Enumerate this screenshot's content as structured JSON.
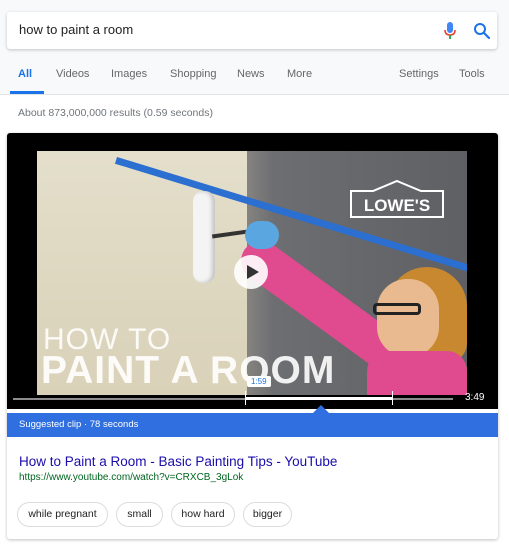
{
  "search": {
    "query": "how to paint a room"
  },
  "tabs": [
    {
      "label": "All",
      "active": true
    },
    {
      "label": "Videos"
    },
    {
      "label": "Images"
    },
    {
      "label": "Shopping"
    },
    {
      "label": "News"
    },
    {
      "label": "More"
    },
    {
      "label": "Settings"
    },
    {
      "label": "Tools"
    }
  ],
  "result_stats": "About 873,000,000 results (0.59 seconds)",
  "video": {
    "overlay_line1": "HOW TO",
    "overlay_line2": "PAINT A ROOM",
    "logo_text": "LOWE'S",
    "clip_timestamp": "1:59",
    "duration": "3:49",
    "suggested_clip": "Suggested clip · 78 seconds"
  },
  "result": {
    "title": "How to Paint a Room - Basic Painting Tips - YouTube",
    "url": "https://www.youtube.com/watch?v=CRXCB_3gLok"
  },
  "chips": [
    "while pregnant",
    "small",
    "how hard",
    "bigger"
  ],
  "colors": {
    "accent": "#1a73e8",
    "suggested_bar": "#2f6fe0",
    "link": "#1a0dab",
    "url": "#006621"
  }
}
